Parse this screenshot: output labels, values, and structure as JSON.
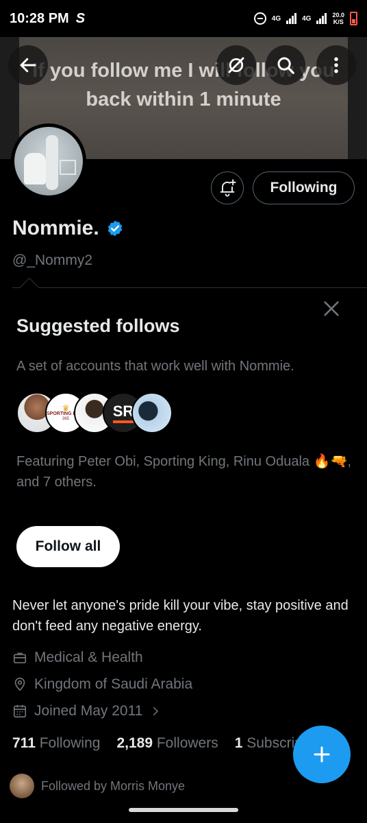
{
  "status_bar": {
    "time": "10:28 PM",
    "app_icon": "S",
    "network_1": "4G",
    "network_2": "4G",
    "speed_value": "20.0",
    "speed_unit": "K/S"
  },
  "banner": {
    "text": "If you follow me I will follow you back within 1 minute"
  },
  "profile": {
    "following_button": "Following",
    "display_name": "Nommie.",
    "handle": "@_Nommy2"
  },
  "suggested": {
    "title": "Suggested follows",
    "description": "A set of accounts that work well with Nommie.",
    "featuring": "Featuring Peter Obi, Sporting King, Rinu Oduala 🔥🔫, and 7 others.",
    "follow_all": "Follow all",
    "avatar_labels": [
      "SPORTING KING",
      "365",
      "SR"
    ]
  },
  "bio": {
    "text": "Never let anyone's pride kill your vibe, stay positive and don't feed any negative energy.",
    "category": "Medical & Health",
    "location": "Kingdom of Saudi Arabia",
    "joined": "Joined May 2011"
  },
  "stats": {
    "following_count": "711",
    "following_label": "Following",
    "followers_count": "2,189",
    "followers_label": "Followers",
    "subs_count": "1",
    "subs_label": "Subscription"
  },
  "followed_by": "Followed by Morris Monye",
  "colors": {
    "accent": "#1d9bf0",
    "background": "#000000",
    "text_primary": "#e7e9ea",
    "text_secondary": "#71767b"
  }
}
